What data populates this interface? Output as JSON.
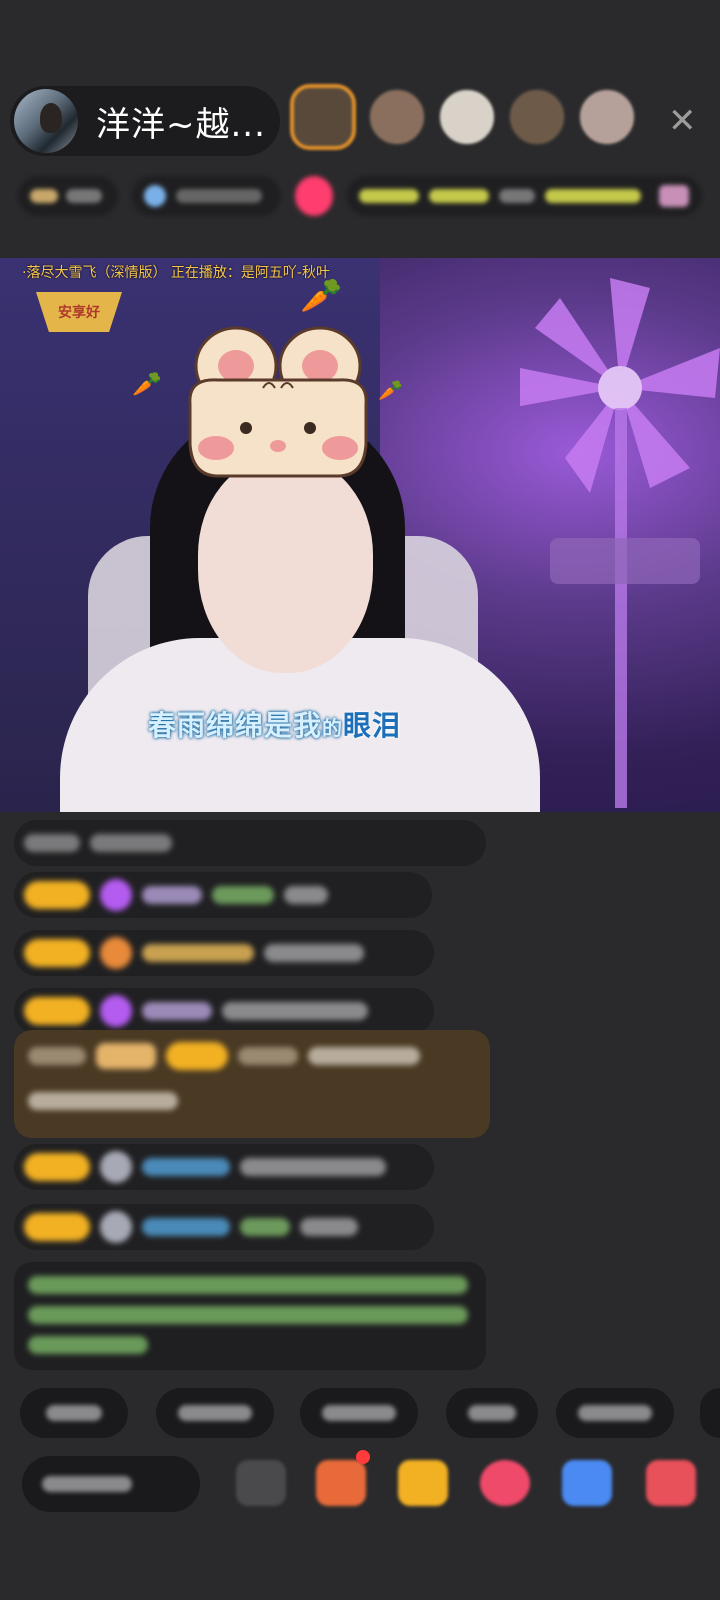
{
  "host": {
    "name": "洋洋~越..."
  },
  "video": {
    "song_line": "·落尽大雪飞（深情版） 正在播放：是阿五吖-秋叶",
    "badge_text": "安享好",
    "lyric_main": "春雨绵绵是我",
    "lyric_small": "的",
    "lyric_end": "眼泪"
  },
  "icons": {
    "close": "close-icon",
    "carrot": "carrot-icon"
  },
  "colors": {
    "level_badge": "#f2b123",
    "gift_banner": "#4a3a24",
    "lyric_highlight": "#1c6fb8",
    "song_line": "#f6c64b"
  }
}
